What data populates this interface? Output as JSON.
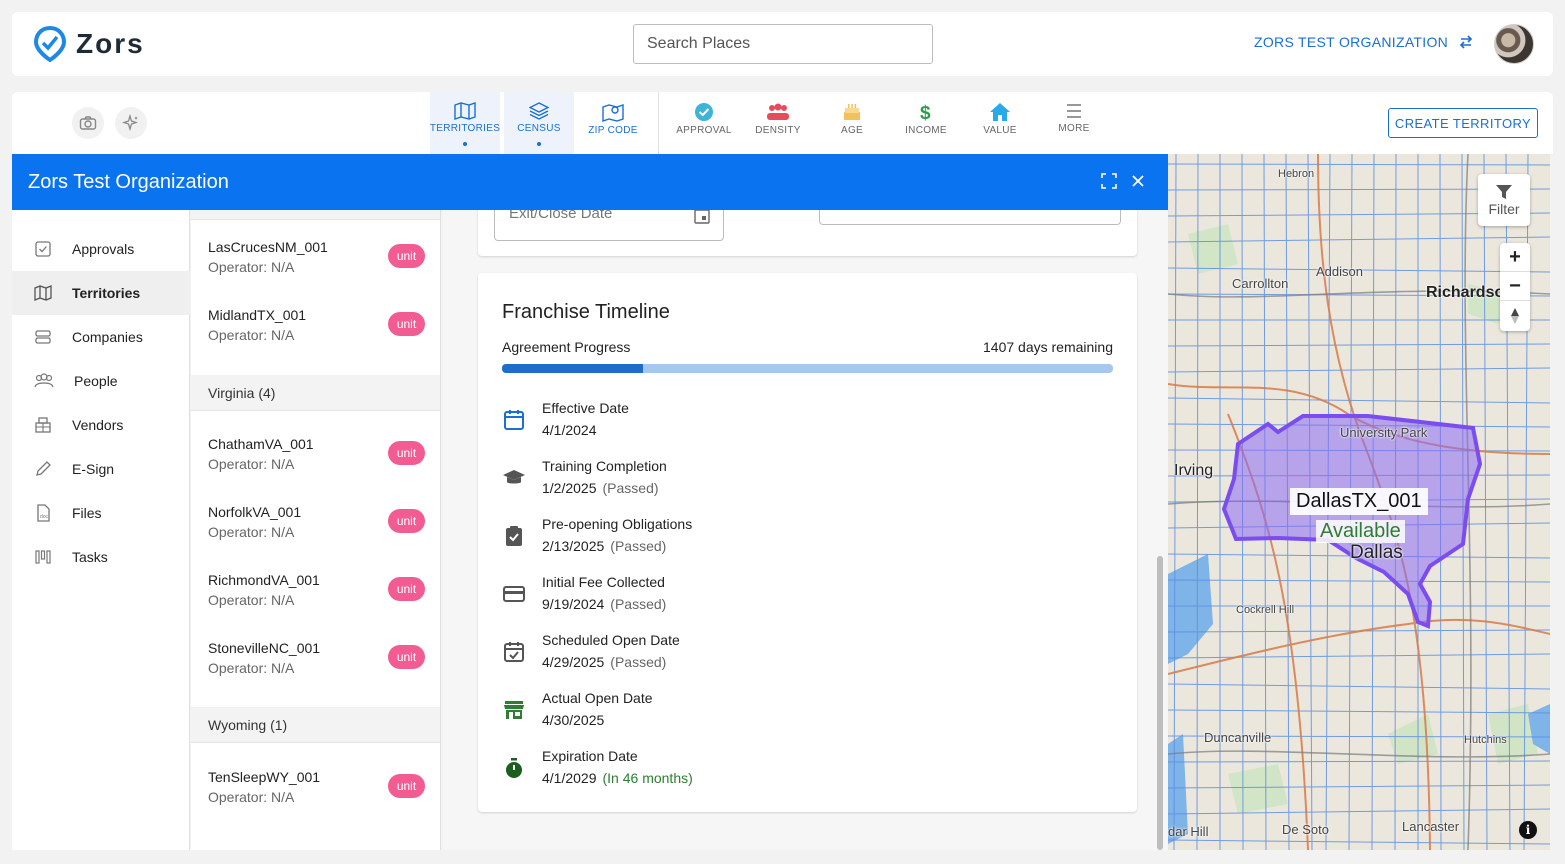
{
  "brand": {
    "name": "Zors"
  },
  "search": {
    "placeholder": "Search Places"
  },
  "org": {
    "name": "ZORS TEST ORGANIZATION"
  },
  "toolbar": {
    "tools": [
      {
        "label": "TERRITORIES",
        "icon": "map-icon",
        "active": true
      },
      {
        "label": "CENSUS",
        "icon": "layers-icon",
        "active": true
      },
      {
        "label": "ZIP CODE",
        "icon": "zip-map-icon",
        "active": false
      },
      {
        "label": "APPROVAL",
        "icon": "check-circle-icon",
        "color": "#3eb5d8"
      },
      {
        "label": "DENSITY",
        "icon": "people-icon",
        "color": "#e64d5c"
      },
      {
        "label": "AGE",
        "icon": "cake-icon",
        "color": "#f2c15c"
      },
      {
        "label": "INCOME",
        "icon": "dollar-icon",
        "color": "#2e9b4a"
      },
      {
        "label": "VALUE",
        "icon": "home-icon",
        "color": "#29a9e8"
      },
      {
        "label": "MORE",
        "icon": "menu-icon",
        "color": "#777"
      }
    ],
    "create_label": "CREATE TERRITORY"
  },
  "panel": {
    "title": "Zors Test Organization"
  },
  "nav": {
    "items": [
      {
        "label": "Approvals",
        "icon": "approval-check-icon"
      },
      {
        "label": "Territories",
        "icon": "map-icon",
        "active": true
      },
      {
        "label": "Companies",
        "icon": "companies-icon"
      },
      {
        "label": "People",
        "icon": "people-icon"
      },
      {
        "label": "Vendors",
        "icon": "vendors-icon"
      },
      {
        "label": "E-Sign",
        "icon": "pen-icon"
      },
      {
        "label": "Files",
        "icon": "file-icon"
      },
      {
        "label": "Tasks",
        "icon": "tasks-icon"
      }
    ]
  },
  "territories": {
    "badge": "unit",
    "rows": [
      {
        "name": "LasCrucesNM_001",
        "operator": "Operator: N/A"
      },
      {
        "name": "MidlandTX_001",
        "operator": "Operator: N/A"
      },
      {
        "name": "ChathamVA_001",
        "operator": "Operator: N/A"
      },
      {
        "name": "NorfolkVA_001",
        "operator": "Operator: N/A"
      },
      {
        "name": "RichmondVA_001",
        "operator": "Operator: N/A"
      },
      {
        "name": "StonevilleNC_001",
        "operator": "Operator: N/A"
      },
      {
        "name": "TenSleepWY_001",
        "operator": "Operator: N/A"
      }
    ],
    "states": [
      {
        "label": "Virginia (4)"
      },
      {
        "label": "Wyoming (1)"
      }
    ]
  },
  "detail": {
    "exit_label": "Exit/Close Date",
    "card_title": "Franchise Timeline",
    "progress_label": "Agreement Progress",
    "days_remaining": "1407 days remaining",
    "progress_fraction": 0.23,
    "items": [
      {
        "title": "Effective Date",
        "date": "4/1/2024",
        "note": "",
        "icon": "calendar-icon"
      },
      {
        "title": "Training Completion",
        "date": "1/2/2025",
        "note": "(Passed)",
        "icon": "graduation-cap-icon"
      },
      {
        "title": "Pre-opening Obligations",
        "date": "2/13/2025",
        "note": "(Passed)",
        "icon": "clipboard-check-icon"
      },
      {
        "title": "Initial Fee Collected",
        "date": "9/19/2024",
        "note": "(Passed)",
        "icon": "credit-card-icon"
      },
      {
        "title": "Scheduled Open Date",
        "date": "4/29/2025",
        "note": "(Passed)",
        "icon": "calendar-check-icon"
      },
      {
        "title": "Actual Open Date",
        "date": "4/30/2025",
        "note": "",
        "icon": "store-icon"
      },
      {
        "title": "Expiration Date",
        "date": "4/1/2029",
        "note": "(In 46 months)",
        "icon": "timer-icon"
      }
    ]
  },
  "map": {
    "filter_label": "Filter",
    "territory_label": "DallasTX_001",
    "status_label": "Available",
    "places": [
      "Hebron",
      "Addison",
      "Carrollton",
      "Richardson",
      "University Park",
      "Irving",
      "Dallas",
      "Cockrell Hill",
      "Duncanville",
      "Hutchins",
      "De Soto",
      "Lancaster",
      "dar Hill"
    ],
    "colors": {
      "territory": "#7b4df0",
      "roads": "#5b8fe0"
    }
  }
}
